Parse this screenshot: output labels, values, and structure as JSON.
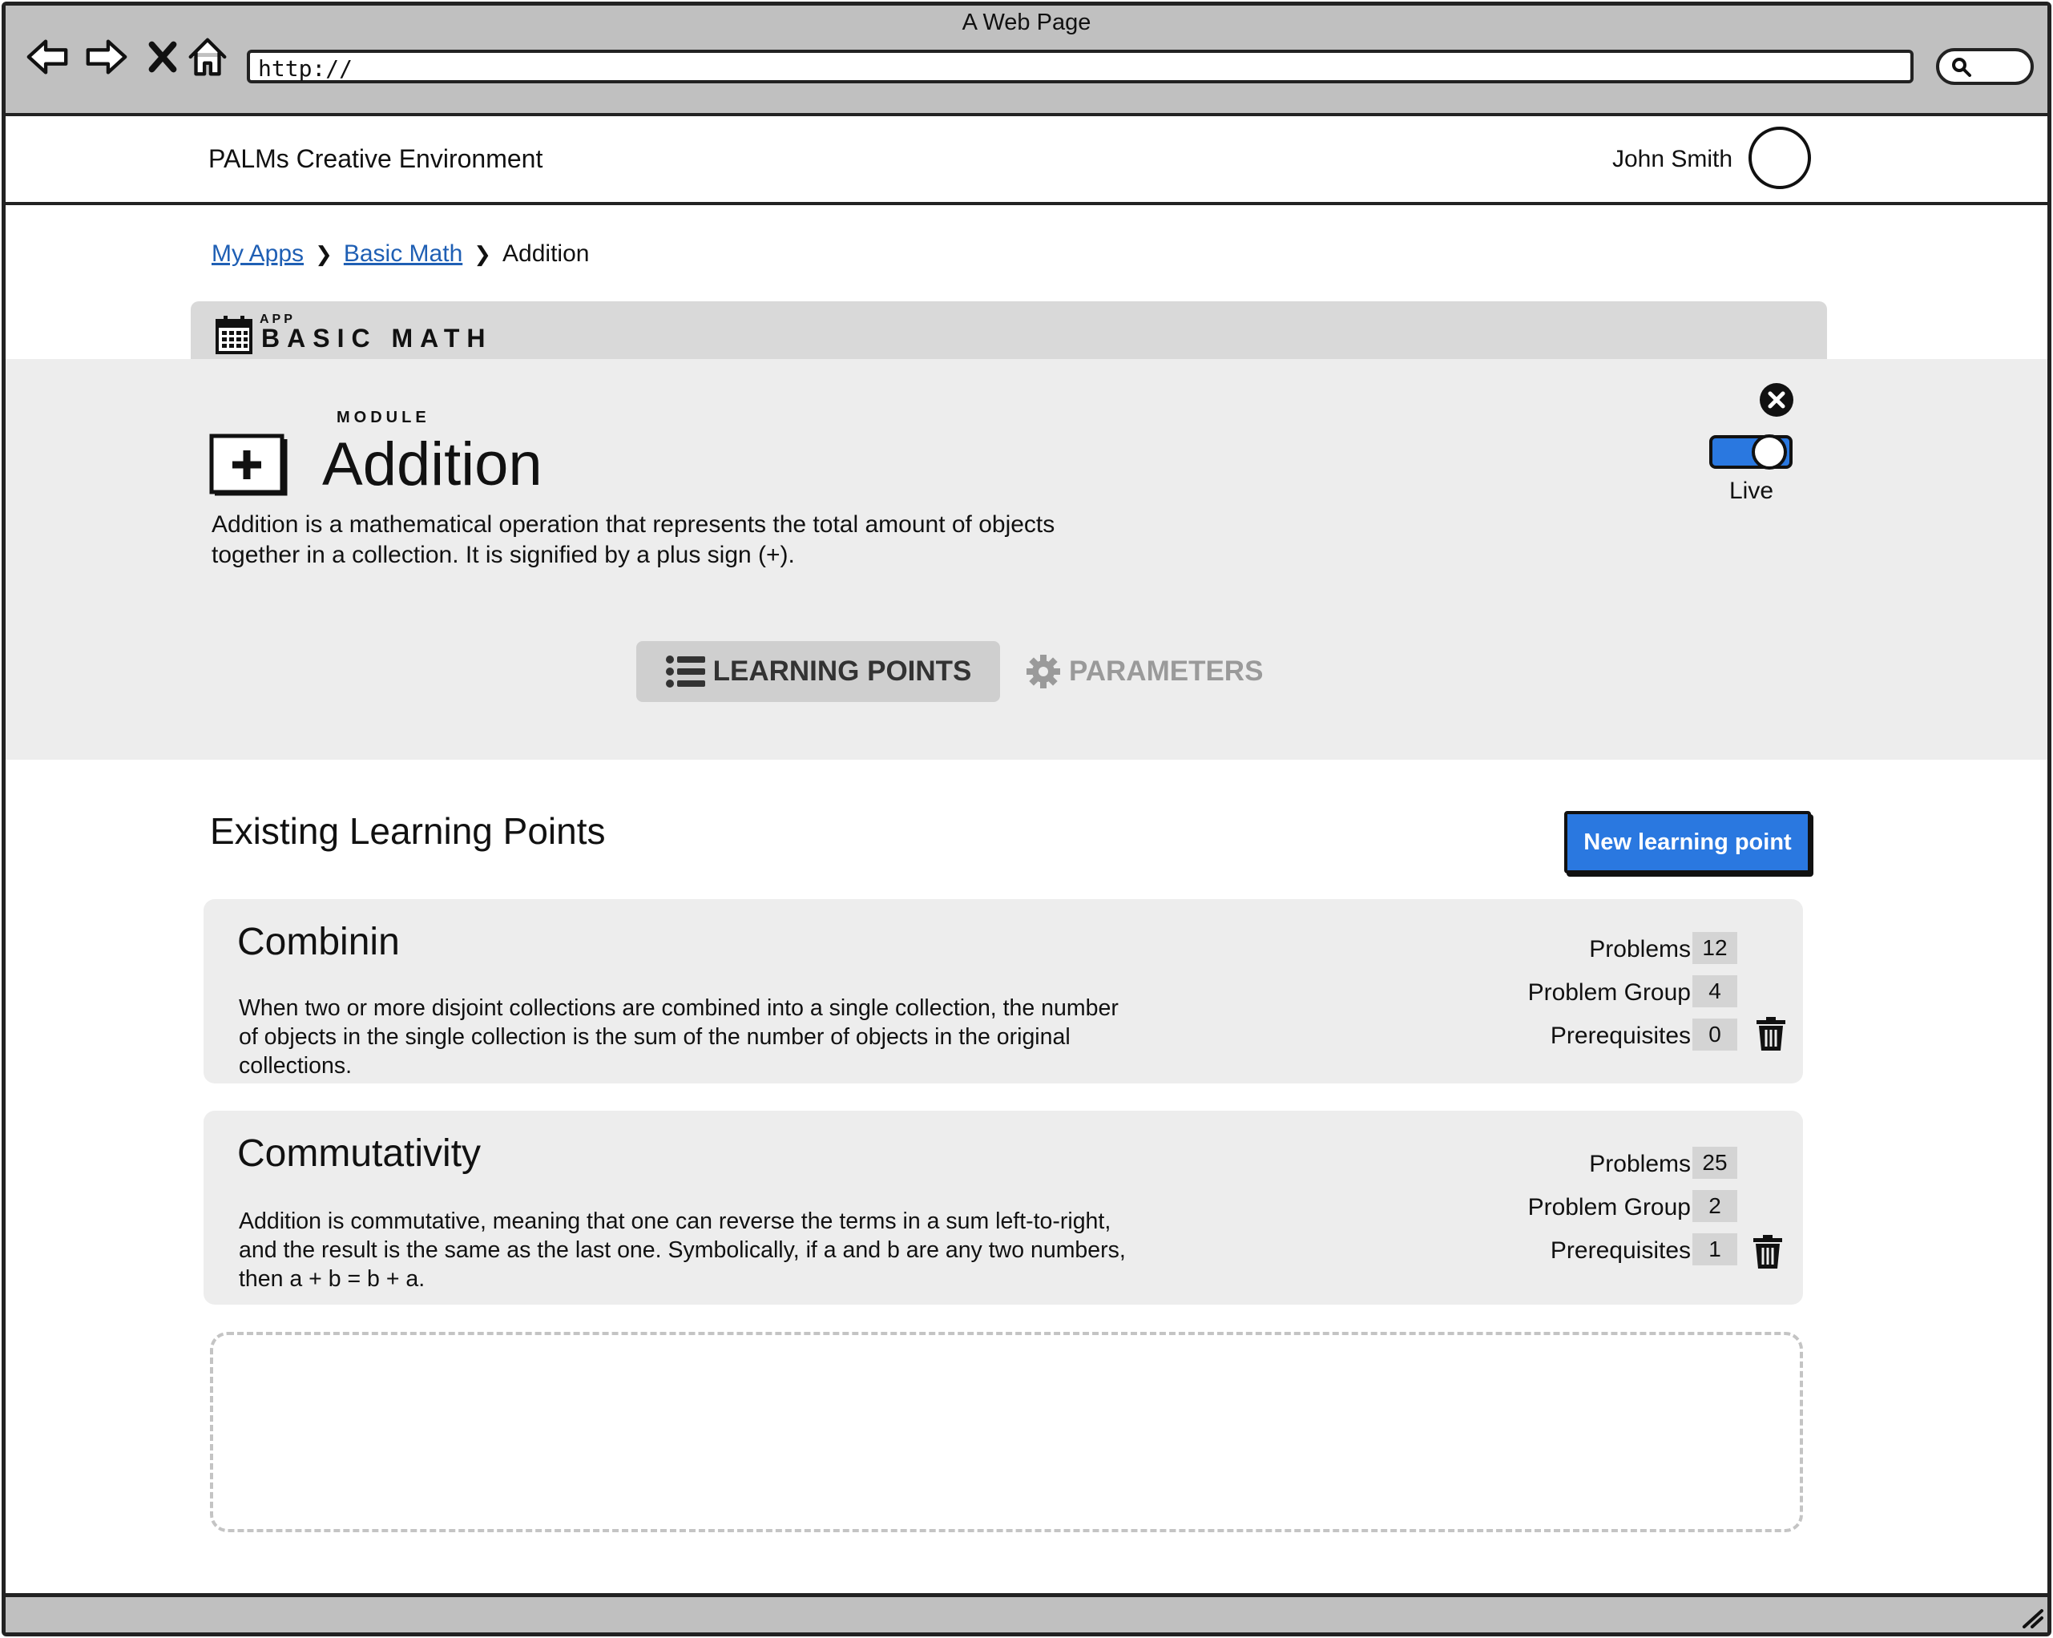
{
  "browser": {
    "window_title": "A Web Page",
    "url": "http://"
  },
  "header": {
    "brand": "PALMs Creative Environment",
    "user_name": "John Smith"
  },
  "breadcrumb": {
    "items": [
      "My Apps",
      "Basic Math"
    ],
    "current": "Addition"
  },
  "app": {
    "kicker": "APP",
    "name": "BASIC MATH"
  },
  "module": {
    "kicker": "MODULE",
    "title": "Addition",
    "description": "Addition is a mathematical operation that represents the total amount of objects together in a collection. It is signified by a plus sign (+).",
    "live_label": "Live",
    "live": true
  },
  "tabs": {
    "learning_points": "LEARNING POINTS",
    "parameters": "PARAMETERS",
    "active": "learning_points"
  },
  "learning_points": {
    "section_title": "Existing Learning Points",
    "new_button": "New learning point",
    "items": [
      {
        "title": "Combinin",
        "description": "When two or more disjoint collections are combined into a single collection, the number of objects in the single collection is the sum of the number of objects in the original collections.",
        "stats": {
          "problems_label": "Problems",
          "problems": "12",
          "group_label": "Problem Group",
          "group": "4",
          "prereq_label": "Prerequisites",
          "prereq": "0"
        }
      },
      {
        "title": "Commutativity",
        "description": "Addition is commutative, meaning that one can reverse the terms in a sum left-to-right, and the result is the same as the last one. Symbolically, if a and b are any two numbers, then a + b = b + a.",
        "stats": {
          "problems_label": "Problems",
          "problems": "25",
          "group_label": "Problem Group",
          "group": "2",
          "prereq_label": "Prerequisites",
          "prereq": "1"
        }
      }
    ]
  },
  "colors": {
    "accent": "#2a78e0",
    "chrome": "#c0c0c0",
    "panel": "#ededed",
    "link": "#1f5fb4"
  },
  "icons": [
    "back-arrow-icon",
    "forward-arrow-icon",
    "stop-icon",
    "home-icon",
    "search-icon",
    "calendar-icon",
    "plus-box-icon",
    "close-icon",
    "toggle-icon",
    "list-icon",
    "gear-icon",
    "trash-icon",
    "resize-grip-icon"
  ]
}
